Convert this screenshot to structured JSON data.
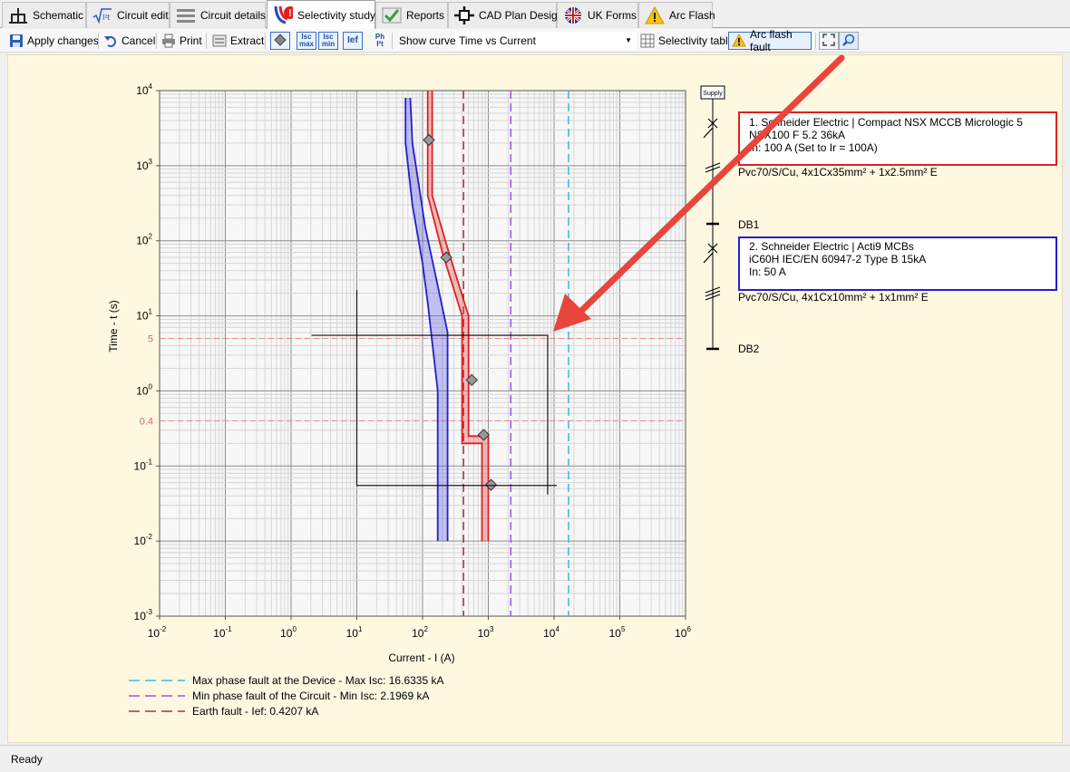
{
  "tabs": [
    {
      "label": "Schematic",
      "icon": "schematic-icon"
    },
    {
      "label": "Circuit edit",
      "icon": "sqrt-i2t-icon"
    },
    {
      "label": "Circuit details",
      "icon": "list-lines-icon"
    },
    {
      "label": "Selectivity study",
      "icon": "selectivity-warning-icon",
      "active": true
    },
    {
      "label": "Reports",
      "icon": "check-icon"
    },
    {
      "label": "CAD Plan Design",
      "icon": "crosshair-icon"
    },
    {
      "label": "UK Forms",
      "icon": "uk-flag-icon"
    },
    {
      "label": "Arc Flash",
      "icon": "warning-triangle-icon"
    }
  ],
  "toolbar": {
    "apply_label": "Apply changes",
    "cancel_label": "Cancel",
    "print_label": "Print",
    "extract_label": "Extract",
    "isc_max_top": "Isc",
    "isc_max_bottom": "max",
    "isc_min_top": "Isc",
    "isc_min_bottom": "min",
    "ief_label": "Ief",
    "ph_top": "Ph",
    "ph_bottom": "I²t",
    "show_curve_label": "Show curve",
    "curve_value": "Time vs Current",
    "selectivity_table_label": "Selectivity table",
    "arc_flash_fault_label": "Arc flash fault"
  },
  "chart": {
    "y_label": "Time - t (s)",
    "x_label": "Current - I (A)",
    "x_ticks": [
      {
        "b": "10",
        "e": "-2"
      },
      {
        "b": "10",
        "e": "-1"
      },
      {
        "b": "10",
        "e": "0"
      },
      {
        "b": "10",
        "e": "1"
      },
      {
        "b": "10",
        "e": "2"
      },
      {
        "b": "10",
        "e": "3"
      },
      {
        "b": "10",
        "e": "4"
      },
      {
        "b": "10",
        "e": "5"
      },
      {
        "b": "10",
        "e": "6"
      }
    ],
    "y_ticks": [
      {
        "b": "10",
        "e": "4"
      },
      {
        "b": "10",
        "e": "3"
      },
      {
        "b": "10",
        "e": "2"
      },
      {
        "b": "10",
        "e": "1"
      },
      {
        "b": "10",
        "e": "0"
      },
      {
        "b": "10",
        "e": "-1"
      },
      {
        "b": "10",
        "e": "-2"
      },
      {
        "b": "10",
        "e": "-3"
      }
    ],
    "h_markers": [
      {
        "label": "5",
        "value": 5
      },
      {
        "label": "0.4",
        "value": 0.4
      }
    ],
    "legend": [
      {
        "label": "Max phase fault at the Device - Max Isc: 16.6335 kA",
        "color": "#33bbdd"
      },
      {
        "label": "Min phase fault of the Circuit - Min Isc: 2.1969 kA",
        "color": "#a050e0"
      },
      {
        "label": "Earth fault - Ief: 0.4207 kA",
        "color": "#aa3333"
      }
    ],
    "colors": {
      "device1": "#e02020",
      "device2": "#2020cc",
      "isc_max": "#33bbdd",
      "isc_min": "#a050e0",
      "ief": "#aa3333"
    }
  },
  "chart_data": {
    "type": "line",
    "x_scale": "log",
    "y_scale": "log",
    "xlim": [
      0.01,
      1000000
    ],
    "ylim": [
      0.001,
      10000
    ],
    "xlabel": "Current - I (A)",
    "ylabel": "Time - t (s)",
    "grid": true,
    "vertical_lines": [
      {
        "name": "Max phase fault at the Device - Max Isc: 16.6335 kA",
        "x": 16633.5
      },
      {
        "name": "Min phase fault of the Circuit - Min Isc: 2.1969 kA",
        "x": 2196.9
      },
      {
        "name": "Earth fault - Ief: 0.4207 kA",
        "x": 420.7
      }
    ],
    "horizontal_lines": [
      5,
      0.4
    ],
    "series": [
      {
        "left": [
          [
            120,
            10000
          ],
          [
            120,
            400
          ],
          [
            200,
            70
          ],
          [
            400,
            10
          ],
          [
            400,
            0.2
          ],
          [
            800,
            0.2
          ],
          [
            800,
            0.01
          ]
        ],
        "right": [
          [
            140,
            10000
          ],
          [
            140,
            400
          ],
          [
            250,
            70
          ],
          [
            500,
            10
          ],
          [
            500,
            0.25
          ],
          [
            1000,
            0.25
          ],
          [
            1000,
            0.01
          ]
        ],
        "markers": [
          [
            125,
            2200
          ],
          [
            230,
            60
          ],
          [
            560,
            1.4
          ],
          [
            850,
            0.26
          ],
          [
            1100,
            0.056
          ]
        ]
      },
      {
        "left": [
          [
            55,
            8000
          ],
          [
            55,
            2000
          ],
          [
            70,
            300
          ],
          [
            100,
            50
          ],
          [
            120,
            15
          ],
          [
            170,
            1
          ],
          [
            170,
            0.01
          ]
        ],
        "right": [
          [
            65,
            8000
          ],
          [
            70,
            2000
          ],
          [
            110,
            150
          ],
          [
            180,
            20
          ],
          [
            240,
            6
          ],
          [
            240,
            0.01
          ]
        ]
      }
    ],
    "arc_box": {
      "x": [
        10,
        8000
      ],
      "t": [
        0.055,
        5.5
      ]
    }
  },
  "diagram": {
    "supply_label": "Supply",
    "device1": {
      "line1": "1. Schneider Electric | Compact NSX MCCB Micrologic 5",
      "line2": "NSX100 F 5.2 36kA",
      "line3": "In: 100 A (Set to Ir = 100A)"
    },
    "cable1": "Pvc70/S/Cu, 4x1Cx35mm² + 1x2.5mm² E",
    "db1": "DB1",
    "device2": {
      "line1": "2. Schneider Electric | Acti9 MCBs",
      "line2": "iC60H IEC/EN 60947-2 Type B 15kA",
      "line3": "In: 50 A"
    },
    "cable2": "Pvc70/S/Cu, 4x1Cx10mm² + 1x1mm² E",
    "db2": "DB2"
  },
  "status": {
    "text": "Ready"
  }
}
